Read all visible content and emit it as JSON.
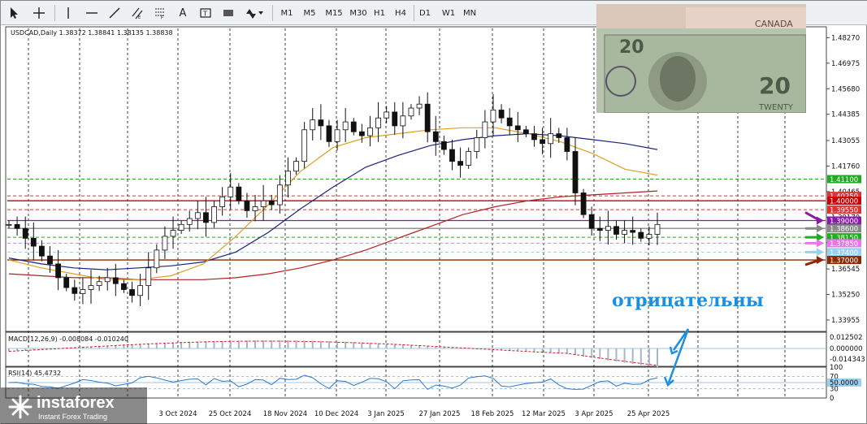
{
  "toolbar": {
    "timeframes": [
      "M1",
      "M5",
      "M15",
      "M30",
      "H1",
      "H4",
      "D1",
      "W1",
      "MN"
    ],
    "tools": [
      "cursor-icon",
      "crosshair-icon",
      "vertical-line-icon",
      "horizontal-line-icon",
      "trendline-icon",
      "equidistant-channel-icon",
      "fibonacci-icon",
      "text-icon",
      "text-label-icon",
      "rectangle-icon",
      "arrows-icon"
    ],
    "text_tool_label": "A",
    "arrow_tool_label": "▶"
  },
  "chart_data": {
    "type": "candlestick",
    "symbol_header": "USDCAD,Daily  1.38372 1.38841 1.38135 1.38838",
    "y_ticks": [
      "1.48270",
      "1.46975",
      "1.45680",
      "1.44385",
      "1.43055",
      "1.41760",
      "1.40465",
      "1.39170",
      "1.37875",
      "1.36545",
      "1.35250",
      "1.33955"
    ],
    "ylim": [
      1.3342,
      1.4882
    ],
    "x_labels": [
      "3 Oct 2024",
      "25 Oct 2024",
      "18 Nov 2024",
      "10 Dec 2024",
      "3 Jan 2025",
      "27 Jan 2025",
      "18 Feb 2025",
      "12 Mar 2025",
      "3 Apr 2025",
      "25 Apr 2025"
    ],
    "levels": [
      {
        "label": "1.41100",
        "value": 1.411,
        "color": "#22aa22",
        "style": "dashed"
      },
      {
        "label": "1.40250",
        "value": 1.4025,
        "color": "#dd3333",
        "style": "dashed"
      },
      {
        "label": "1.40000",
        "value": 1.4,
        "color": "#cc0000",
        "style": "solid"
      },
      {
        "label": "1.39550",
        "value": 1.3955,
        "color": "#dd3333",
        "style": "dashed"
      },
      {
        "label": "1.39000",
        "value": 1.39,
        "color": "#8a1aa8",
        "style": "solid"
      },
      {
        "label": "1.38600",
        "value": 1.386,
        "color": "#888888",
        "style": "solid"
      },
      {
        "label": "1.38150",
        "value": 1.3815,
        "color": "#22aa22",
        "style": "dashed"
      },
      {
        "label": "1.37850",
        "value": 1.3785,
        "color": "#e878e8",
        "style": "dashed"
      },
      {
        "label": "1.37400",
        "value": 1.374,
        "color": "#9ad0f0",
        "style": "dashed"
      },
      {
        "label": "1.37000",
        "value": 1.37,
        "color": "#8b2a00",
        "style": "solid"
      }
    ],
    "close_series": [
      1.388,
      1.386,
      1.381,
      1.377,
      1.372,
      1.368,
      1.361,
      1.356,
      1.353,
      1.355,
      1.357,
      1.359,
      1.361,
      1.358,
      1.355,
      1.352,
      1.357,
      1.366,
      1.375,
      1.382,
      1.385,
      1.388,
      1.391,
      1.394,
      1.389,
      1.397,
      1.402,
      1.407,
      1.4,
      1.395,
      1.397,
      1.4,
      1.398,
      1.408,
      1.415,
      1.42,
      1.436,
      1.441,
      1.438,
      1.43,
      1.436,
      1.44,
      1.435,
      1.433,
      1.437,
      1.442,
      1.445,
      1.438,
      1.443,
      1.447,
      1.449,
      1.435,
      1.43,
      1.426,
      1.42,
      1.418,
      1.425,
      1.432,
      1.44,
      1.446,
      1.442,
      1.438,
      1.436,
      1.434,
      1.431,
      1.429,
      1.434,
      1.432,
      1.425,
      1.404,
      1.393,
      1.386,
      1.385,
      1.387,
      1.383,
      1.385,
      1.384,
      1.381,
      1.383,
      1.388
    ],
    "ma_slow": [
      1.363,
      1.362,
      1.361,
      1.361,
      1.36,
      1.36,
      1.36,
      1.361,
      1.363,
      1.366,
      1.37,
      1.375,
      1.381,
      1.387,
      1.393,
      1.397,
      1.4,
      1.402,
      1.403,
      1.404,
      1.405
    ],
    "ma_mid": [
      1.371,
      1.368,
      1.366,
      1.365,
      1.366,
      1.367,
      1.369,
      1.374,
      1.384,
      1.396,
      1.407,
      1.417,
      1.423,
      1.428,
      1.431,
      1.433,
      1.434,
      1.433,
      1.431,
      1.429,
      1.426
    ],
    "ma_fast": [
      1.37,
      1.366,
      1.363,
      1.36,
      1.36,
      1.362,
      1.368,
      1.382,
      1.398,
      1.415,
      1.427,
      1.432,
      1.434,
      1.436,
      1.437,
      1.437,
      1.434,
      1.43,
      1.424,
      1.416,
      1.413
    ],
    "macd": {
      "header": "MACD(12,26,9) -0.008084 -0.010240",
      "y_ticks": [
        "0.012502",
        "0.000000",
        "-0.014343"
      ]
    },
    "rsi": {
      "header": "RSI(14) 45.4732",
      "y_ticks": [
        "100",
        "70",
        "50.0000",
        "30",
        "0"
      ]
    },
    "colors": {
      "ma_slow": "#b22222",
      "ma_mid": "#1a237e",
      "ma_fast": "#e0a020",
      "candle": "#111111",
      "rsi_line": "#2a78c8",
      "macd_signal": "#cc2222",
      "macd_hist": "#a9b6c8",
      "grid": "#111111"
    }
  },
  "annotation": {
    "text": "отрицательны",
    "color": "#1b8fe0"
  },
  "logo": {
    "brand": "instaforex",
    "tagline": "Instant Forex Trading"
  }
}
